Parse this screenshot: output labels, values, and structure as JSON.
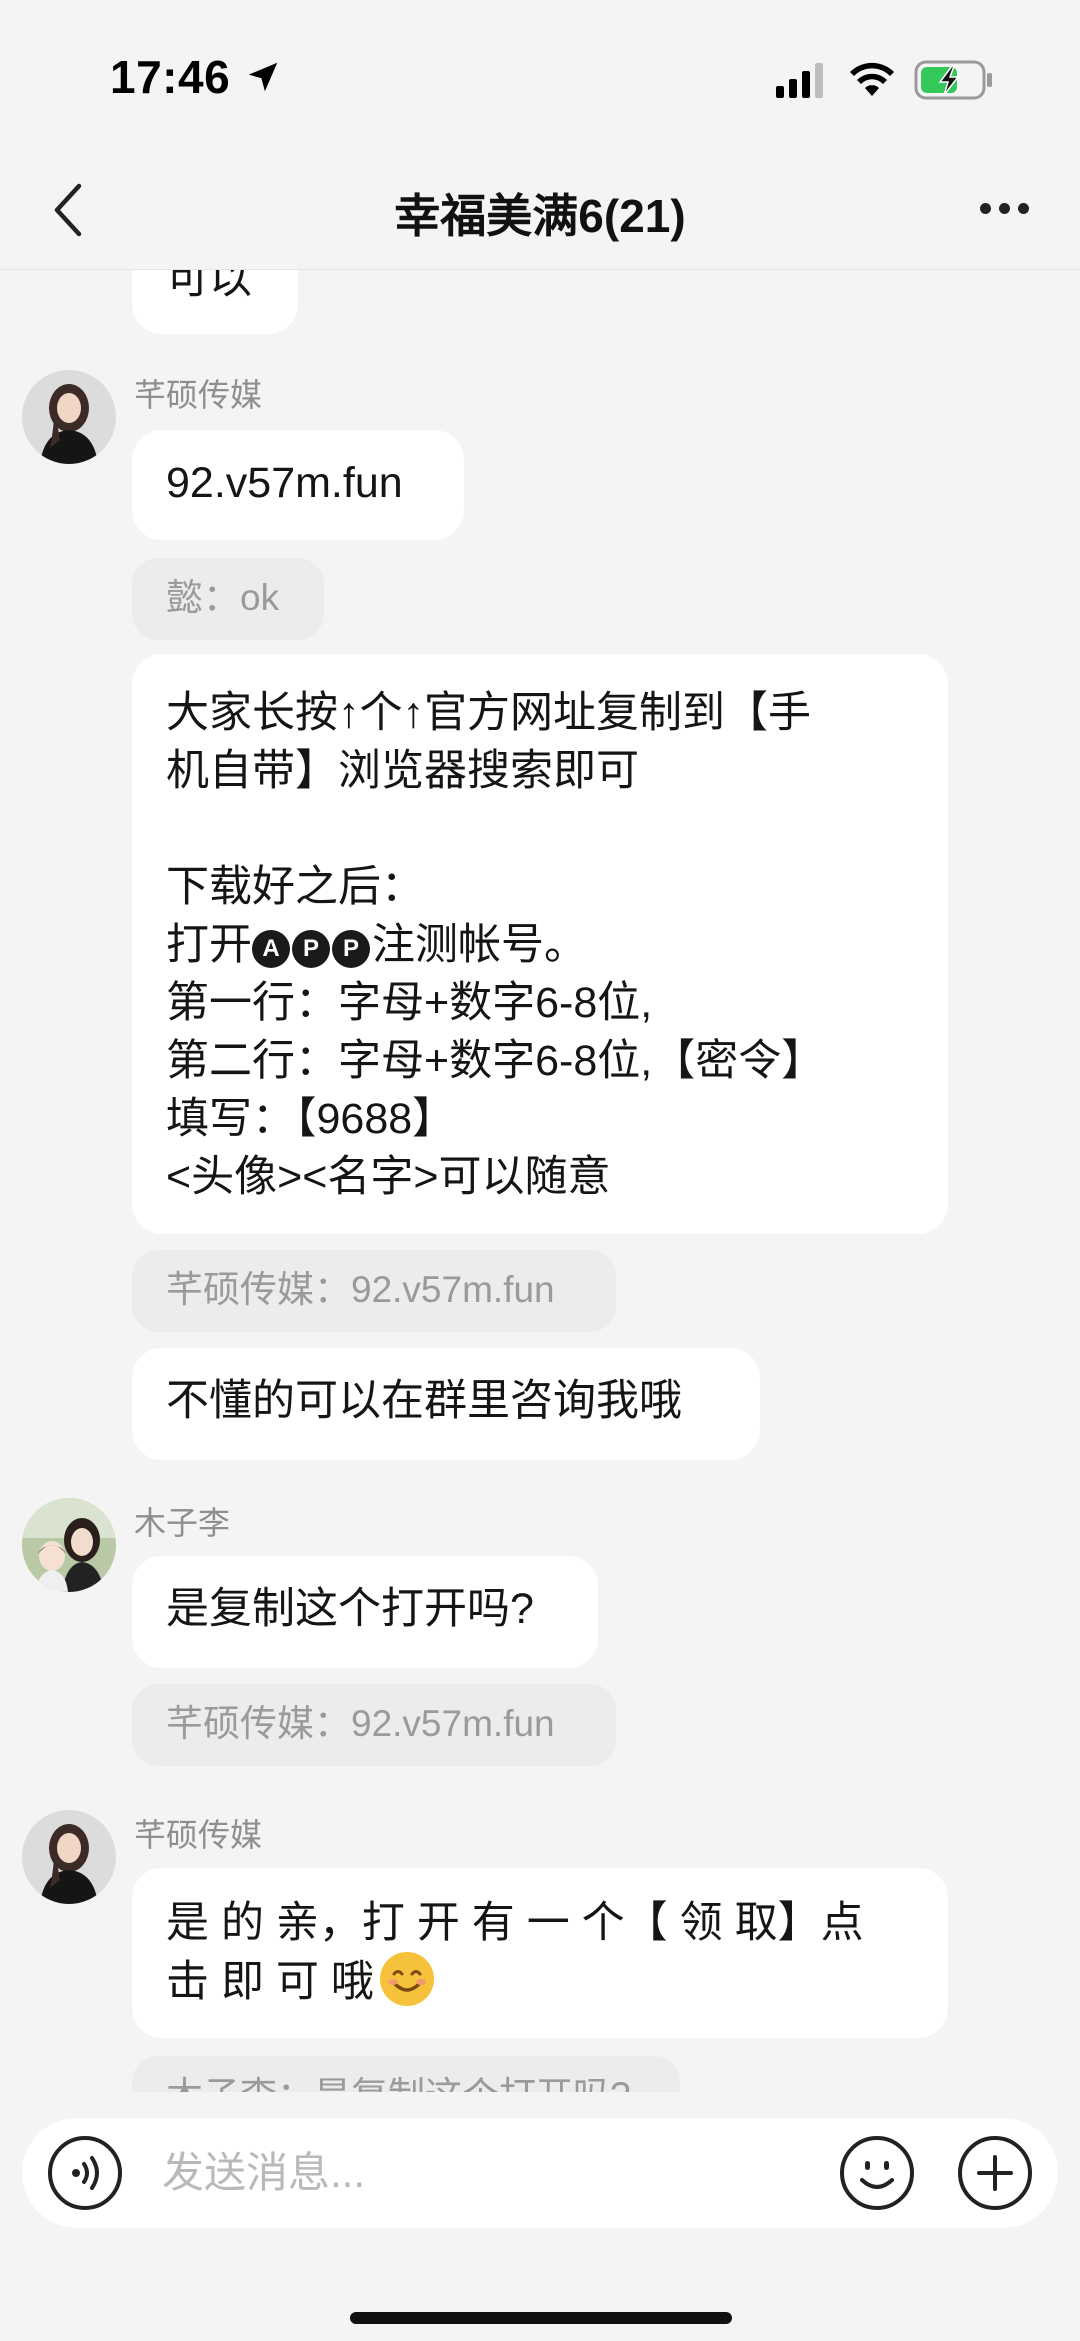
{
  "status_bar": {
    "time": "17:46"
  },
  "nav": {
    "title": "幸福美满6(21)"
  },
  "messages": {
    "m0_text": "可以",
    "m1_sender": "芊硕传媒",
    "m1_text": "92.v57m.fun",
    "m2_reply": "懿：ok",
    "m3_line1": "大家长按↑个↑官方网址复制到【手",
    "m3_line2": "机自带】浏览器搜索即可",
    "m3_line3": "下载好之后：",
    "m3_line4_pre": "打开",
    "m3_app_letters": [
      "A",
      "P",
      "P"
    ],
    "m3_line4_post": "注测帐号。",
    "m3_line5": "第一行：字母+数字6-8位,",
    "m3_line6": "第二行：字母+数字6-8位,【密令】",
    "m3_line7": "填写：【9688】",
    "m3_line8": "<头像><名字>可以随意",
    "m4_reply": "芊硕传媒：92.v57m.fun",
    "m5_text": "不懂的可以在群里咨询我哦",
    "m6_sender": "木子李",
    "m6_text": "是复制这个打开吗?",
    "m7_reply": "芊硕传媒：92.v57m.fun",
    "m8_sender": "芊硕传媒",
    "m8_line1": "是 的 亲，打 开 有 一 个【 领 取】点",
    "m8_line2": "击 即   可 哦",
    "m9_reply": "木子李：是复制这个打开吗?"
  },
  "input": {
    "placeholder": "发送消息..."
  },
  "colors": {
    "background": "#f4f4f4",
    "bubble": "#ffffff",
    "reply_bubble": "#ececec",
    "reply_text": "#9a9a9a"
  },
  "icons": [
    "location-arrow-icon",
    "signal-icon",
    "wifi-icon",
    "battery-charging-icon",
    "back-chevron-icon",
    "more-dots-icon",
    "voice-icon",
    "emoji-icon",
    "add-icon"
  ]
}
